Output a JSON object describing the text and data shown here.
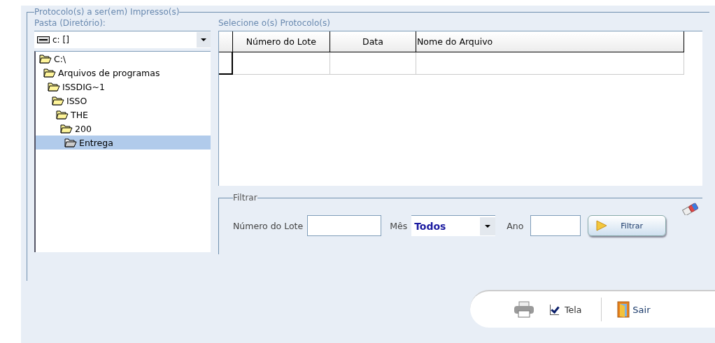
{
  "group_title": "Protocolo(s) a ser(em) Impresso(s)",
  "folder": {
    "label": "Pasta (Diretório):",
    "drive": "c: []",
    "tree": [
      {
        "label": "C:\\",
        "selected": false,
        "children": [
          {
            "label": "Arquivos de programas",
            "selected": false,
            "children": [
              {
                "label": "ISSDIG~1",
                "selected": false,
                "children": [
                  {
                    "label": "ISSO",
                    "selected": false,
                    "children": [
                      {
                        "label": "THE",
                        "selected": false,
                        "children": [
                          {
                            "label": "200",
                            "selected": false,
                            "children": [
                              {
                                "label": "Entrega",
                                "selected": true
                              }
                            ]
                          }
                        ]
                      }
                    ]
                  }
                ]
              }
            ]
          }
        ]
      }
    ]
  },
  "protocols": {
    "label": "Selecione o(s) Protocolo(s)",
    "columns": [
      "Número do Lote",
      "Data",
      "Nome do Arquivo"
    ]
  },
  "filter": {
    "title": "Filtrar",
    "lote_label": "Número do Lote",
    "mes_label": "Mês",
    "mes_value": "Todos",
    "ano_label": "Ano",
    "button": "Filtrar"
  },
  "footer": {
    "tela": {
      "label": "Tela",
      "checked": true
    },
    "sair": "Sair"
  }
}
